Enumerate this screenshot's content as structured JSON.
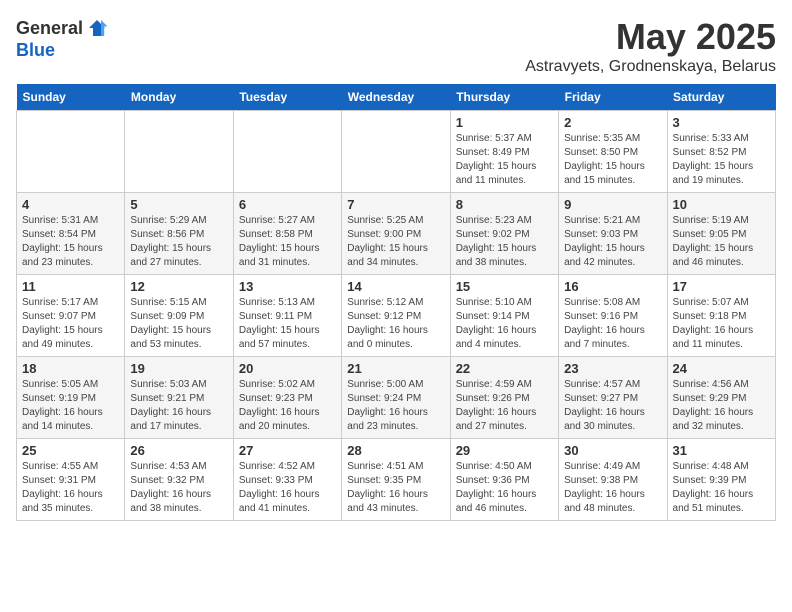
{
  "logo": {
    "general": "General",
    "blue": "Blue"
  },
  "title": {
    "month": "May 2025",
    "location": "Astravyets, Grodnenskaya, Belarus"
  },
  "days_of_week": [
    "Sunday",
    "Monday",
    "Tuesday",
    "Wednesday",
    "Thursday",
    "Friday",
    "Saturday"
  ],
  "weeks": [
    [
      {
        "day": "",
        "info": ""
      },
      {
        "day": "",
        "info": ""
      },
      {
        "day": "",
        "info": ""
      },
      {
        "day": "",
        "info": ""
      },
      {
        "day": "1",
        "info": "Sunrise: 5:37 AM\nSunset: 8:49 PM\nDaylight: 15 hours\nand 11 minutes."
      },
      {
        "day": "2",
        "info": "Sunrise: 5:35 AM\nSunset: 8:50 PM\nDaylight: 15 hours\nand 15 minutes."
      },
      {
        "day": "3",
        "info": "Sunrise: 5:33 AM\nSunset: 8:52 PM\nDaylight: 15 hours\nand 19 minutes."
      }
    ],
    [
      {
        "day": "4",
        "info": "Sunrise: 5:31 AM\nSunset: 8:54 PM\nDaylight: 15 hours\nand 23 minutes."
      },
      {
        "day": "5",
        "info": "Sunrise: 5:29 AM\nSunset: 8:56 PM\nDaylight: 15 hours\nand 27 minutes."
      },
      {
        "day": "6",
        "info": "Sunrise: 5:27 AM\nSunset: 8:58 PM\nDaylight: 15 hours\nand 31 minutes."
      },
      {
        "day": "7",
        "info": "Sunrise: 5:25 AM\nSunset: 9:00 PM\nDaylight: 15 hours\nand 34 minutes."
      },
      {
        "day": "8",
        "info": "Sunrise: 5:23 AM\nSunset: 9:02 PM\nDaylight: 15 hours\nand 38 minutes."
      },
      {
        "day": "9",
        "info": "Sunrise: 5:21 AM\nSunset: 9:03 PM\nDaylight: 15 hours\nand 42 minutes."
      },
      {
        "day": "10",
        "info": "Sunrise: 5:19 AM\nSunset: 9:05 PM\nDaylight: 15 hours\nand 46 minutes."
      }
    ],
    [
      {
        "day": "11",
        "info": "Sunrise: 5:17 AM\nSunset: 9:07 PM\nDaylight: 15 hours\nand 49 minutes."
      },
      {
        "day": "12",
        "info": "Sunrise: 5:15 AM\nSunset: 9:09 PM\nDaylight: 15 hours\nand 53 minutes."
      },
      {
        "day": "13",
        "info": "Sunrise: 5:13 AM\nSunset: 9:11 PM\nDaylight: 15 hours\nand 57 minutes."
      },
      {
        "day": "14",
        "info": "Sunrise: 5:12 AM\nSunset: 9:12 PM\nDaylight: 16 hours\nand 0 minutes."
      },
      {
        "day": "15",
        "info": "Sunrise: 5:10 AM\nSunset: 9:14 PM\nDaylight: 16 hours\nand 4 minutes."
      },
      {
        "day": "16",
        "info": "Sunrise: 5:08 AM\nSunset: 9:16 PM\nDaylight: 16 hours\nand 7 minutes."
      },
      {
        "day": "17",
        "info": "Sunrise: 5:07 AM\nSunset: 9:18 PM\nDaylight: 16 hours\nand 11 minutes."
      }
    ],
    [
      {
        "day": "18",
        "info": "Sunrise: 5:05 AM\nSunset: 9:19 PM\nDaylight: 16 hours\nand 14 minutes."
      },
      {
        "day": "19",
        "info": "Sunrise: 5:03 AM\nSunset: 9:21 PM\nDaylight: 16 hours\nand 17 minutes."
      },
      {
        "day": "20",
        "info": "Sunrise: 5:02 AM\nSunset: 9:23 PM\nDaylight: 16 hours\nand 20 minutes."
      },
      {
        "day": "21",
        "info": "Sunrise: 5:00 AM\nSunset: 9:24 PM\nDaylight: 16 hours\nand 23 minutes."
      },
      {
        "day": "22",
        "info": "Sunrise: 4:59 AM\nSunset: 9:26 PM\nDaylight: 16 hours\nand 27 minutes."
      },
      {
        "day": "23",
        "info": "Sunrise: 4:57 AM\nSunset: 9:27 PM\nDaylight: 16 hours\nand 30 minutes."
      },
      {
        "day": "24",
        "info": "Sunrise: 4:56 AM\nSunset: 9:29 PM\nDaylight: 16 hours\nand 32 minutes."
      }
    ],
    [
      {
        "day": "25",
        "info": "Sunrise: 4:55 AM\nSunset: 9:31 PM\nDaylight: 16 hours\nand 35 minutes."
      },
      {
        "day": "26",
        "info": "Sunrise: 4:53 AM\nSunset: 9:32 PM\nDaylight: 16 hours\nand 38 minutes."
      },
      {
        "day": "27",
        "info": "Sunrise: 4:52 AM\nSunset: 9:33 PM\nDaylight: 16 hours\nand 41 minutes."
      },
      {
        "day": "28",
        "info": "Sunrise: 4:51 AM\nSunset: 9:35 PM\nDaylight: 16 hours\nand 43 minutes."
      },
      {
        "day": "29",
        "info": "Sunrise: 4:50 AM\nSunset: 9:36 PM\nDaylight: 16 hours\nand 46 minutes."
      },
      {
        "day": "30",
        "info": "Sunrise: 4:49 AM\nSunset: 9:38 PM\nDaylight: 16 hours\nand 48 minutes."
      },
      {
        "day": "31",
        "info": "Sunrise: 4:48 AM\nSunset: 9:39 PM\nDaylight: 16 hours\nand 51 minutes."
      }
    ]
  ]
}
